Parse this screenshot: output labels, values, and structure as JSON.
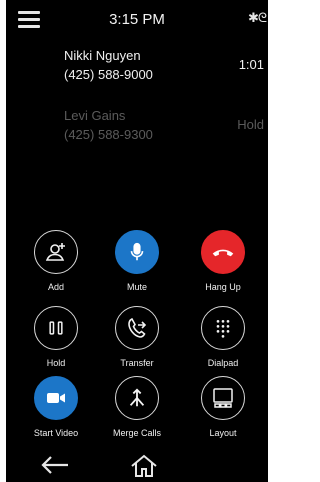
{
  "status_bar": {
    "time": "3:15 PM",
    "menu_icon": "hamburger-menu-icon",
    "indicators": "bluetooth-icon, signal-icon"
  },
  "calls": [
    {
      "name": "Nikki Nguyen",
      "phone": "(425) 588-9000",
      "status": "1:01",
      "state": "active"
    },
    {
      "name": "Levi Gains",
      "phone": "(425) 588-9300",
      "status": "Hold",
      "state": "held"
    }
  ],
  "controls": {
    "add": {
      "label": "Add",
      "icon": "add-person-icon"
    },
    "mute": {
      "label": "Mute",
      "icon": "microphone-icon",
      "color": "#1c76c8"
    },
    "hang_up": {
      "label": "Hang Up",
      "icon": "hang-up-icon",
      "color": "#e5262a"
    },
    "hold": {
      "label": "Hold",
      "icon": "pause-icon"
    },
    "transfer": {
      "label": "Transfer",
      "icon": "transfer-call-icon"
    },
    "dialpad": {
      "label": "Dialpad",
      "icon": "dialpad-icon"
    },
    "start_video": {
      "label": "Start Video",
      "icon": "video-camera-icon",
      "color": "#1c76c8"
    },
    "merge_calls": {
      "label": "Merge Calls",
      "icon": "merge-icon"
    },
    "layout": {
      "label": "Layout",
      "icon": "layout-icon"
    }
  },
  "nav": {
    "back_icon": "back-arrow-icon",
    "home_icon": "home-icon"
  }
}
